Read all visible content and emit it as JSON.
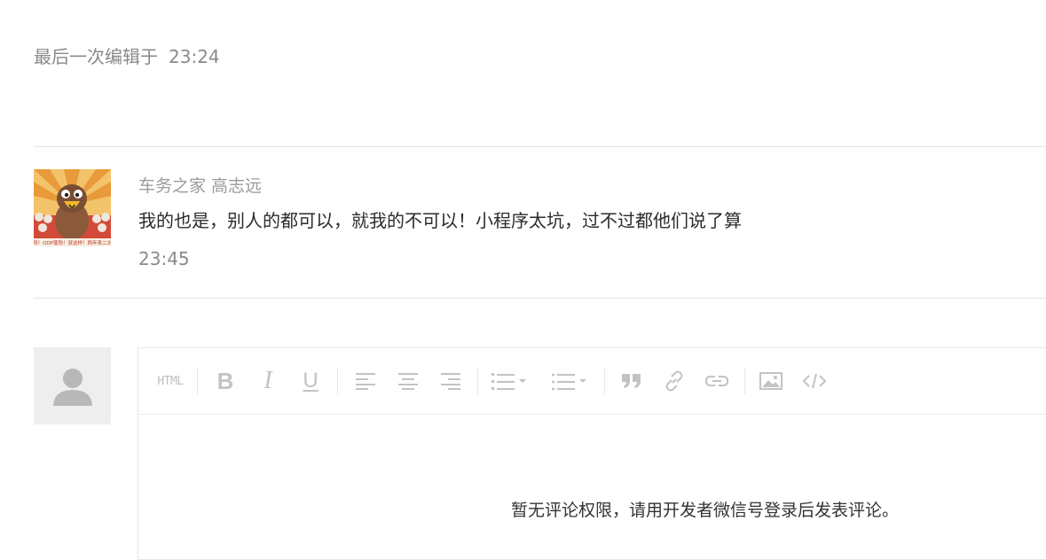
{
  "header": {
    "last_edited_label": "最后一次编辑于",
    "last_edited_time": "23:24"
  },
  "comment": {
    "author": "车务之家 高志远",
    "content": "我的也是，别人的都可以，就我的不可以！小程序太坑，过不过都他们说了算",
    "time": "23:45",
    "avatar_caption": "酷我呀！ODP蓬勃！就这样！两年来二次元！"
  },
  "editor": {
    "toolbar": {
      "html_label": "HTML",
      "bold_label": "B",
      "italic_label": "I",
      "underline_label": "U"
    },
    "no_permission_message": "暂无评论权限，请用开发者微信号登录后发表评论。"
  },
  "colors": {
    "muted_text": "#8a8a8a",
    "icon_gray": "#c3c3c3",
    "divider": "#e5e5e5",
    "avatar_placeholder_bg": "#eeeeef"
  }
}
